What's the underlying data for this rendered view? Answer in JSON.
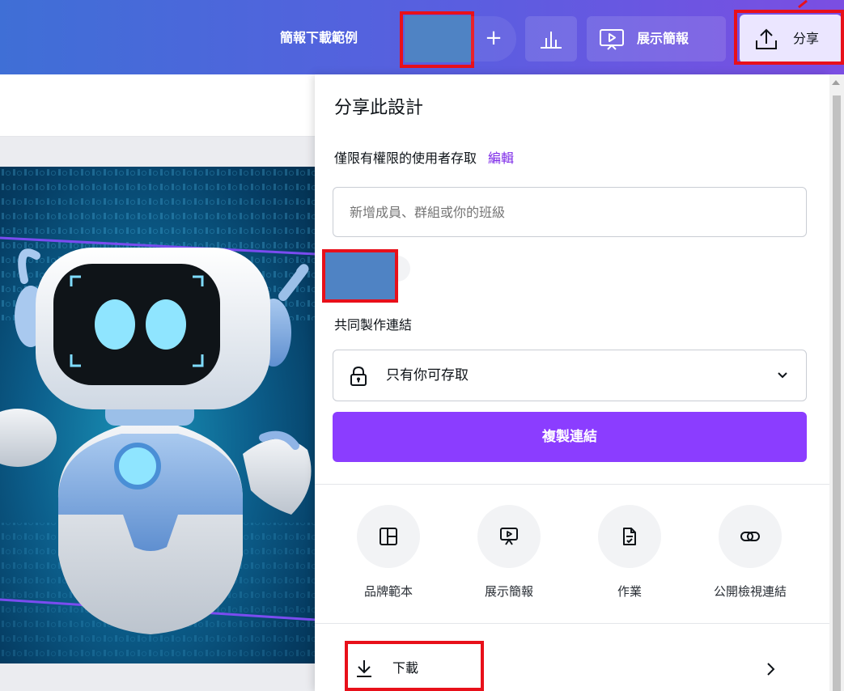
{
  "header": {
    "doc_title": "簡報下載範例",
    "plus_label": "+",
    "present_label": "展示簡報",
    "share_label": "分享"
  },
  "share_panel": {
    "title": "分享此設計",
    "access_text": "僅限有權限的使用者存取",
    "edit_link": "編輯",
    "member_placeholder": "新增成員、群組或你的班級",
    "collab_link_label": "共同製作連結",
    "access_option": "只有你可存取",
    "copy_link_button": "複製連結",
    "options": [
      {
        "label": "品牌範本",
        "icon": "brand-template-icon"
      },
      {
        "label": "展示簡報",
        "icon": "present-icon"
      },
      {
        "label": "作業",
        "icon": "assignment-icon"
      },
      {
        "label": "公開檢視連結",
        "icon": "link-icon"
      }
    ],
    "download_label": "下載"
  },
  "colors": {
    "accent": "#8b3dff",
    "edit_link": "#7d2ae8",
    "annotation": "#e8101a",
    "redaction": "#4f83c4"
  }
}
